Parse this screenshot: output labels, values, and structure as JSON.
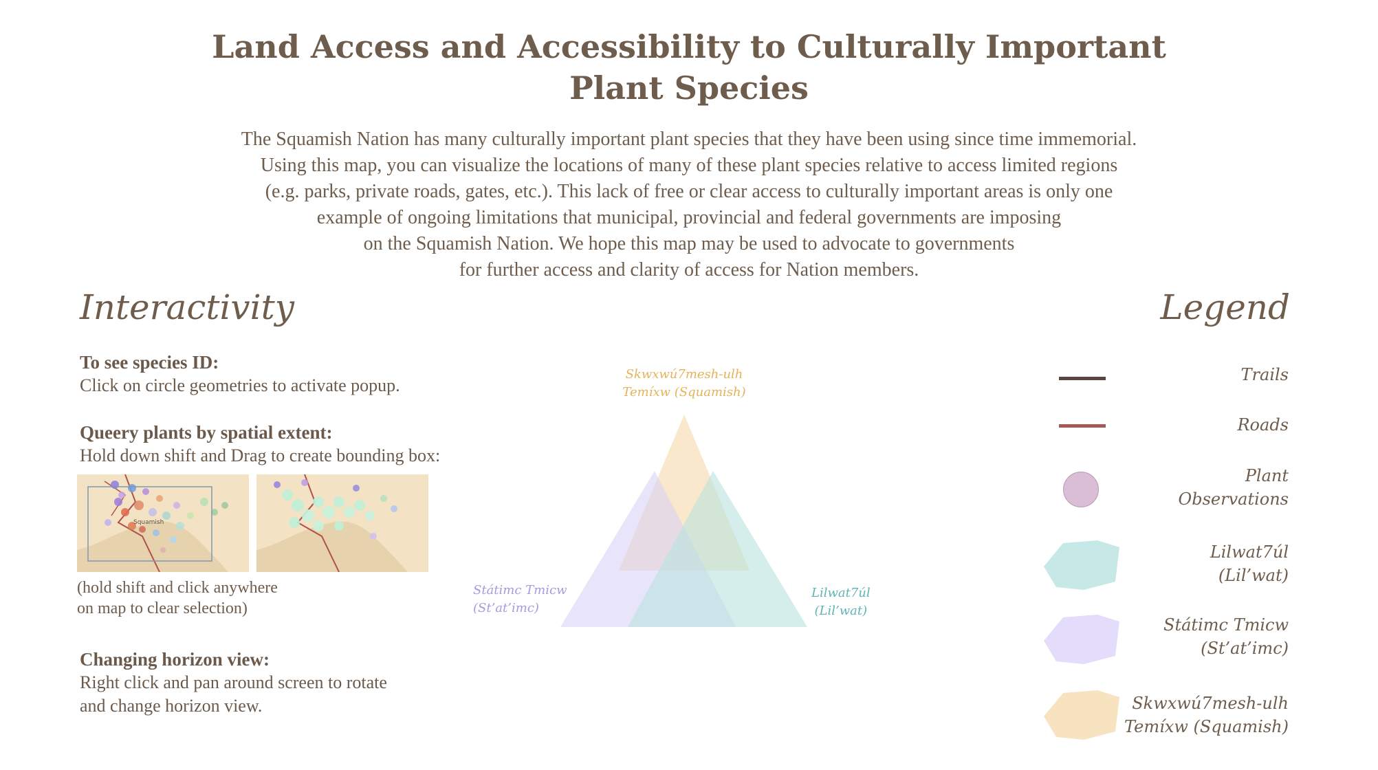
{
  "header": {
    "title_line1": "Land Access and Accessibility to Culturally Important",
    "title_line2": "Plant Species"
  },
  "intro": {
    "lines": [
      "The Squamish Nation has many culturally important plant species that they have been using since time immemorial.",
      "Using this map, you can visualize the locations of many of these plant species relative to access limited regions",
      "(e.g. parks, private roads, gates, etc.). This lack of free or clear access to culturally important areas is only one",
      "example of ongoing limitations that municipal, provincial and federal governments are imposing",
      "on the Squamish Nation. We hope this map may be used to advocate to governments",
      "for further access and clarity of access for Nation members."
    ]
  },
  "interactivity": {
    "heading": "Interactivity",
    "items": [
      {
        "title": "To see species ID:",
        "body": "Click on circle geometries to activate popup."
      },
      {
        "title": "Queery plants by spatial extent:",
        "body": "Hold down shift and Drag to create bounding box:"
      },
      {
        "title": "Changing horizon view:",
        "body": "Right click and pan around screen to rotate",
        "body2": "and change horizon view."
      }
    ],
    "caption_line1": "(hold shift and click anywhere",
    "caption_line2": "on map to clear selection)",
    "thumb_label": "Squamish"
  },
  "triangle": {
    "top_line1": "Skwxwú7mesh-ulh",
    "top_line2": "Temíxw (Squamish)",
    "left_line1": "Státimc Tmicw",
    "left_line2": "(St’at’imc)",
    "right_line1": "Lilwat7úl",
    "right_line2": "(Lil’wat)",
    "colors": {
      "squamish": "#f5d9a8",
      "statimc": "#d9d2f5",
      "lilwat": "#b9e3e0",
      "squamish_text": "#e6b25a",
      "statimc_text": "#a59be0",
      "lilwat_text": "#5fb3b3"
    }
  },
  "legend": {
    "heading": "Legend",
    "items": [
      {
        "label": "Trails",
        "color": "#5b4540"
      },
      {
        "label": "Roads",
        "color": "#a65a55"
      },
      {
        "label_line1": "Plant",
        "label_line2": "Observations",
        "color": "#d9bed6"
      },
      {
        "label_line1": "Lilwat7úl",
        "label_line2": "(Lil’wat)",
        "color": "#c6e8e6"
      },
      {
        "label_line1": "Státimc Tmicw",
        "label_line2": "(St’at’imc)",
        "color": "#e3dcfa"
      },
      {
        "label_line1": "Skwxwú7mesh-ulh",
        "label_line2": "Temíxw (Squamish)",
        "color": "#f7e3c0"
      }
    ]
  }
}
